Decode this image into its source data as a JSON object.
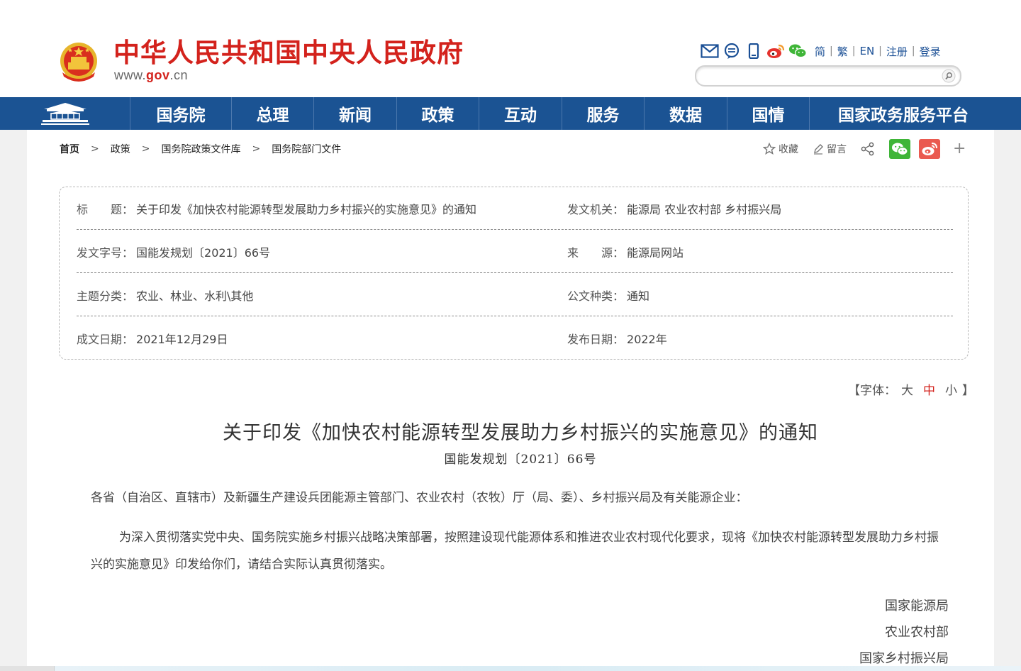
{
  "header": {
    "site_title": "中华人民共和国中央人民政府",
    "site_domain_prefix": "www.",
    "site_domain_mid": "gov",
    "site_domain_suffix": ".cn",
    "tool_icons": [
      "mail-icon",
      "message-icon",
      "mobile-icon",
      "weibo-icon",
      "wechat-icon"
    ],
    "links": [
      "简",
      "繁",
      "EN",
      "注册",
      "登录"
    ],
    "search_placeholder": ""
  },
  "nav": {
    "items": [
      "国务院",
      "总理",
      "新闻",
      "政策",
      "互动",
      "服务",
      "数据",
      "国情",
      "国家政务服务平台"
    ]
  },
  "breadcrumb": [
    "首页",
    "政策",
    "国务院政策文件库",
    "国务院部门文件"
  ],
  "share": {
    "favorite": "收藏",
    "comment": "留言",
    "plus": "+"
  },
  "info": {
    "title_label": "标　　题：",
    "title_value": "关于印发《加快农村能源转型发展助力乡村振兴的实施意见》的通知",
    "issuer_label": "发文机关：",
    "issuer_value": "能源局  农业农村部  乡村振兴局",
    "docno_label": "发文字号：",
    "docno_value": "国能发规划〔2021〕66号",
    "source_label": "来　　源：",
    "source_value": "能源局网站",
    "topic_label": "主题分类：",
    "topic_value": "农业、林业、水利\\其他",
    "type_label": "公文种类：",
    "type_value": "通知",
    "written_label": "成文日期：",
    "written_value": "2021年12月29日",
    "published_label": "发布日期：",
    "published_value": "2022年"
  },
  "fontctl": {
    "open": "【字体：",
    "large": "大",
    "medium": "中",
    "small": "小",
    "close": "】"
  },
  "article": {
    "title": "关于印发《加快农村能源转型发展助力乡村振兴的实施意见》的通知",
    "docno": "国能发规划〔2021〕66号",
    "salutation": "各省（自治区、直辖市）及新疆生产建设兵团能源主管部门、农业农村（农牧）厅（局、委）、乡村振兴局及有关能源企业：",
    "body": "为深入贯彻落实党中央、国务院实施乡村振兴战略决策部署，按照建设现代能源体系和推进农业农村现代化要求，现将《加快农村能源转型发展助力乡村振兴的实施意见》印发给你们，请结合实际认真贯彻落实。",
    "signatures": [
      "国家能源局",
      "农业农村部",
      "国家乡村振兴局"
    ]
  },
  "colors": {
    "brand_red": "#d3221c",
    "nav_blue": "#1b5393",
    "link_blue": "#1a4f95",
    "wechat_green": "#3fb538",
    "weibo_red": "#ea5a50"
  }
}
